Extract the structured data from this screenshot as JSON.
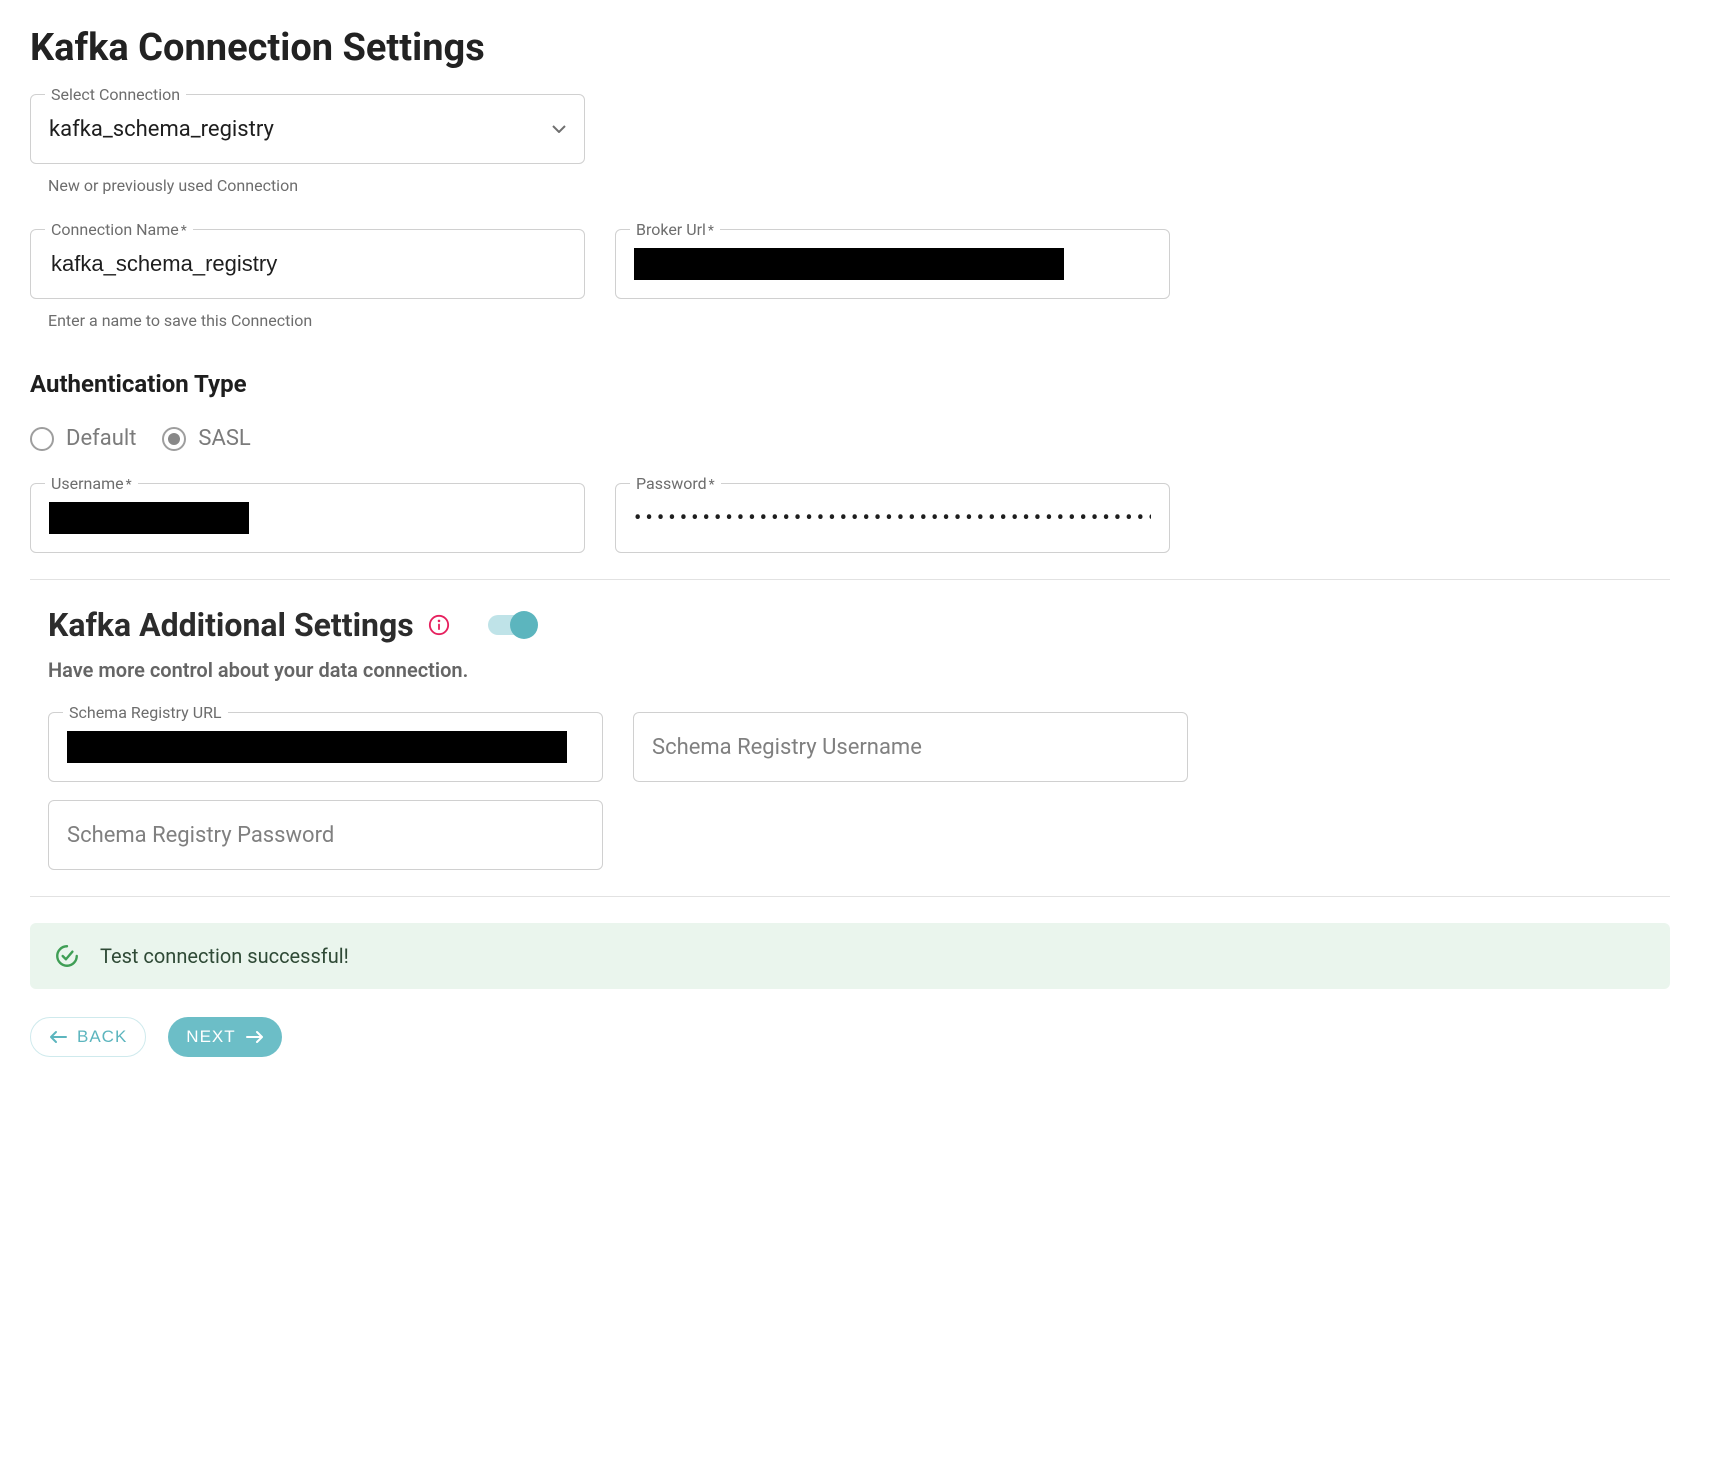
{
  "title": "Kafka Connection Settings",
  "select_connection": {
    "label": "Select Connection",
    "value": "kafka_schema_registry",
    "helper": "New or previously used Connection"
  },
  "connection_name": {
    "label": "Connection Name",
    "required": "*",
    "value": "kafka_schema_registry",
    "helper": "Enter a name to save this Connection"
  },
  "broker_url": {
    "label": "Broker Url",
    "required": "*",
    "value_redacted": true
  },
  "auth": {
    "title": "Authentication Type",
    "options": [
      {
        "label": "Default",
        "selected": false
      },
      {
        "label": "SASL",
        "selected": true
      }
    ]
  },
  "username": {
    "label": "Username",
    "required": "*",
    "value_redacted": true
  },
  "password": {
    "label": "Password",
    "required": "*",
    "mask": "•••••••••••••••••••••••••••••••••••••••••••••••••••••••••••••••••••••"
  },
  "additional": {
    "title": "Kafka Additional Settings",
    "subtitle": "Have more control about your data connection.",
    "toggle_on": true,
    "schema_registry_url": {
      "label": "Schema Registry URL",
      "value_redacted": true
    },
    "schema_registry_username": {
      "placeholder": "Schema Registry Username"
    },
    "schema_registry_password": {
      "placeholder": "Schema Registry Password"
    }
  },
  "alert": {
    "text": "Test connection successful!"
  },
  "buttons": {
    "back": "BACK",
    "next": "NEXT"
  }
}
